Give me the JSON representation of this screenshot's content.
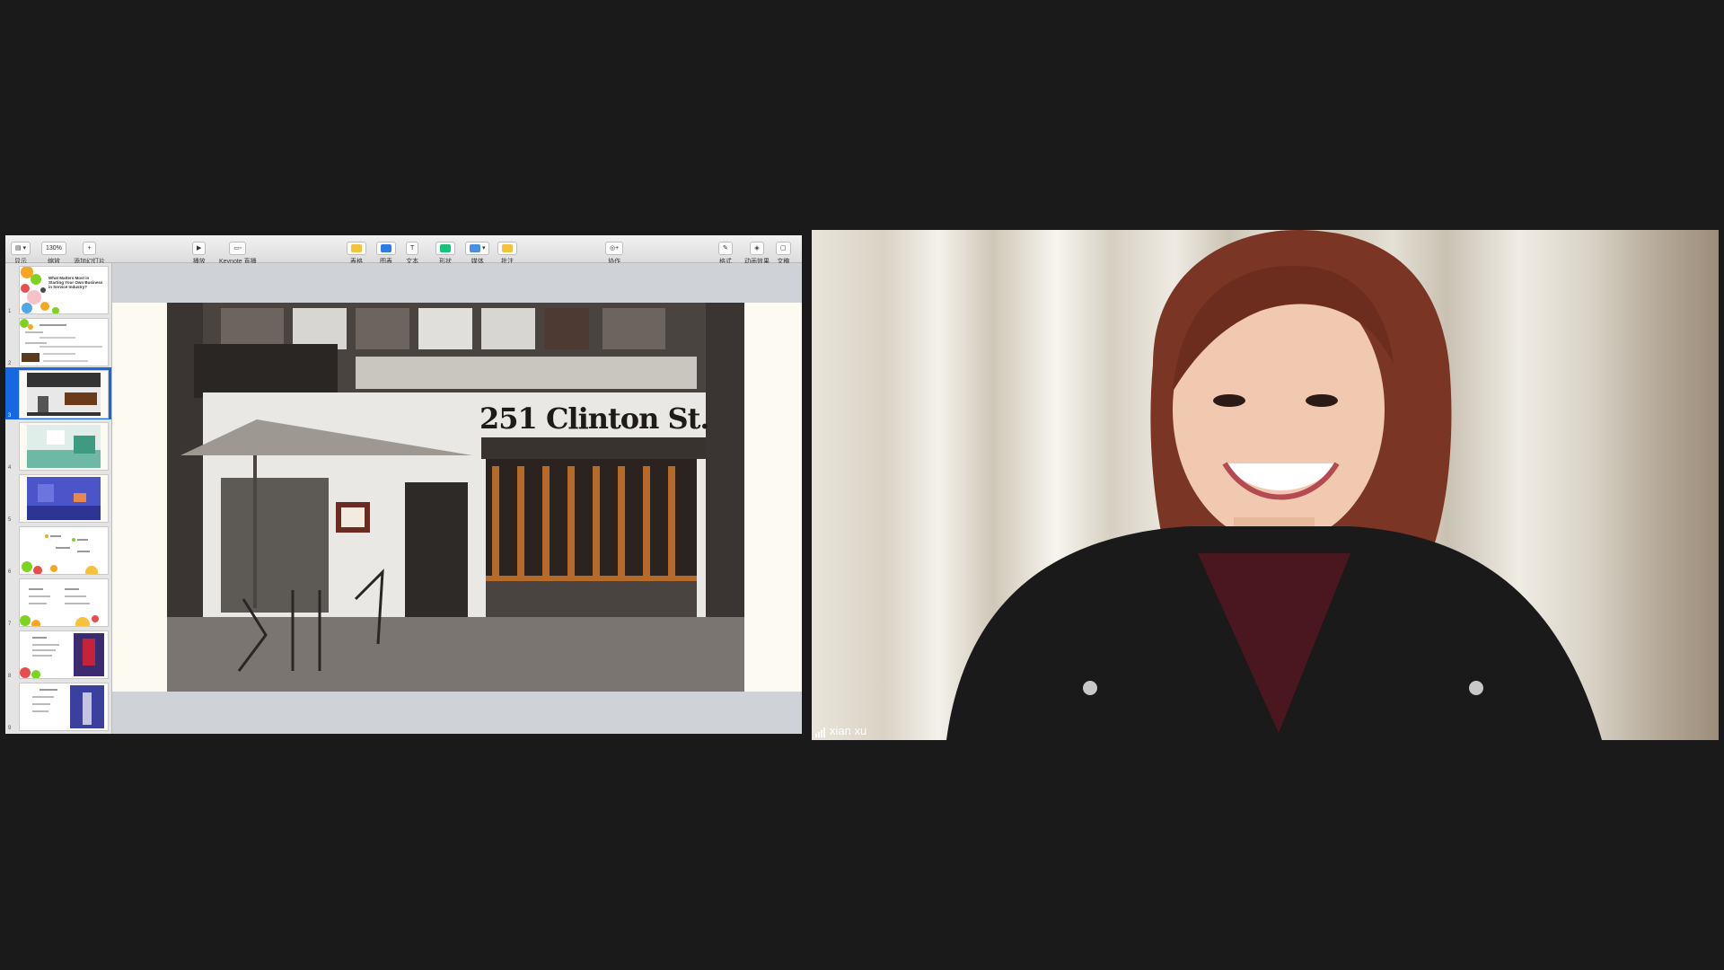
{
  "keynote": {
    "toolbar": {
      "view_label": "显示",
      "zoom_value": "130%",
      "zoom_label": "缩放",
      "add_slide_label": "添加幻灯片",
      "play_label": "播放",
      "keynote_live_label": "Keynote 直播",
      "table_label": "表格",
      "chart_label": "图表",
      "text_label": "文本",
      "shape_label": "形状",
      "media_label": "媒体",
      "comment_label": "批注",
      "collaborate_label": "协作",
      "format_label": "格式",
      "animate_label": "动画效果",
      "document_label": "文稿",
      "colors": {
        "table": "#f5c33b",
        "chart": "#2f7be6",
        "shape": "#19c37d",
        "media": "#4a90e2",
        "comment": "#f5c33b"
      }
    },
    "navigator": {
      "selected_index": 2,
      "slides": [
        {
          "number": "1",
          "text": "What Matters Most in Starting Your Own Business in Service Industry?"
        },
        {
          "number": "2",
          "text": ""
        },
        {
          "number": "3",
          "text": ""
        },
        {
          "number": "4",
          "text": ""
        },
        {
          "number": "5",
          "text": ""
        },
        {
          "number": "6",
          "text": ""
        },
        {
          "number": "7",
          "text": ""
        },
        {
          "number": "8",
          "text": ""
        },
        {
          "number": "9",
          "text": ""
        }
      ]
    },
    "slide": {
      "sign_text": "251 Clinton St."
    }
  },
  "video": {
    "participant_name": "xian xu",
    "signal_icon": "signal-bars-icon"
  }
}
